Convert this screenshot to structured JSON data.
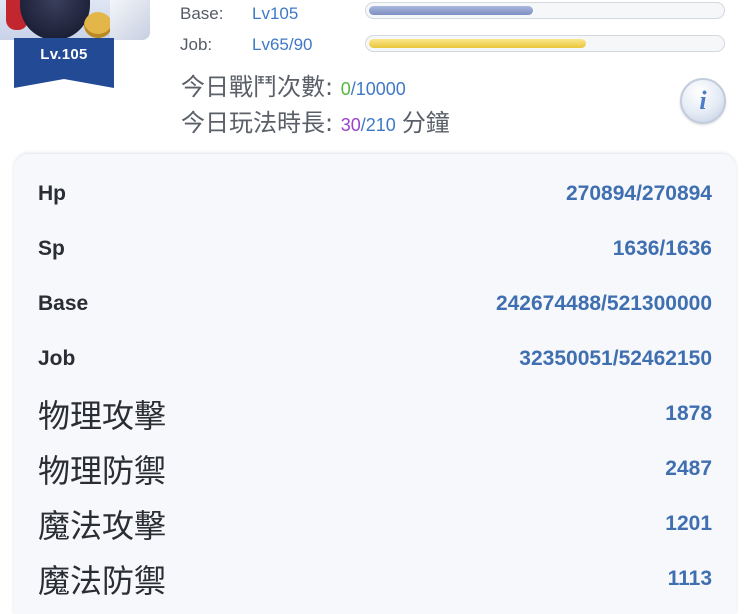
{
  "character": {
    "level_badge": "Lv.105",
    "base_exp": {
      "label": "Base:",
      "level": "Lv105",
      "progress": 0.466
    },
    "job_exp": {
      "label": "Job:",
      "level": "Lv65/90",
      "progress": 0.617
    }
  },
  "daily": {
    "battle": {
      "label": "今日戰鬥次數:",
      "current": "0",
      "max": "/10000"
    },
    "play_time": {
      "label": "今日玩法時長:",
      "current": "30",
      "max": "/210",
      "unit": "分鐘"
    }
  },
  "stats": [
    {
      "label": "Hp",
      "value": "270894/270894"
    },
    {
      "label": "Sp",
      "value": "1636/1636"
    },
    {
      "label": "Base",
      "value": "242674488/521300000"
    },
    {
      "label": "Job",
      "value": "32350051/52462150"
    },
    {
      "label": "物理攻擊",
      "value": "1878"
    },
    {
      "label": "物理防禦",
      "value": "2487"
    },
    {
      "label": "魔法攻擊",
      "value": "1201"
    },
    {
      "label": "魔法防禦",
      "value": "1113"
    }
  ],
  "colors": {
    "accent_blue": "#3f79c6",
    "battle_count": "#56b83a",
    "play_time": "#9b42c8",
    "level_banner": "#234a94"
  },
  "icons": {
    "info": "info-icon"
  }
}
